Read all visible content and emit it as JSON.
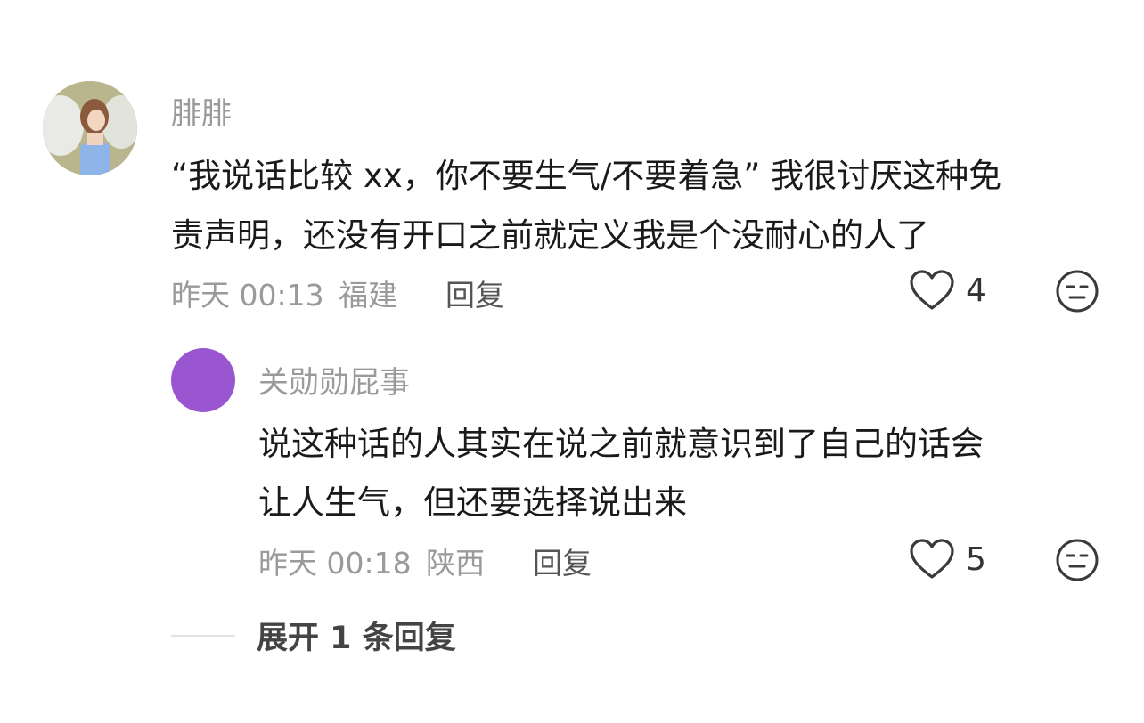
{
  "comment": {
    "username": "腓腓",
    "text_line1": "“我说话比较 xx，你不要生气/不要着急” 我很讨厌这种免",
    "text_line2": "责声明，还没有开口之前就定义我是个没耐心的人了",
    "time": "昨天 00:13",
    "location": "福建",
    "reply_label": "回复",
    "likes": "4",
    "like_icon": "heart-outline-icon",
    "emoji_icon": "neutral-face-icon"
  },
  "reply": {
    "username": "关勋勋屁事",
    "avatar_color": "#9a55d0",
    "text_line1": "说这种话的人其实在说之前就意识到了自己的话会",
    "text_line2": "让人生气，但还要选择说出来",
    "time": "昨天 00:18",
    "location": "陕西",
    "reply_label": "回复",
    "likes": "5",
    "like_icon": "heart-outline-icon",
    "emoji_icon": "neutral-face-icon"
  },
  "expand": {
    "label": "展开 1 条回复"
  }
}
